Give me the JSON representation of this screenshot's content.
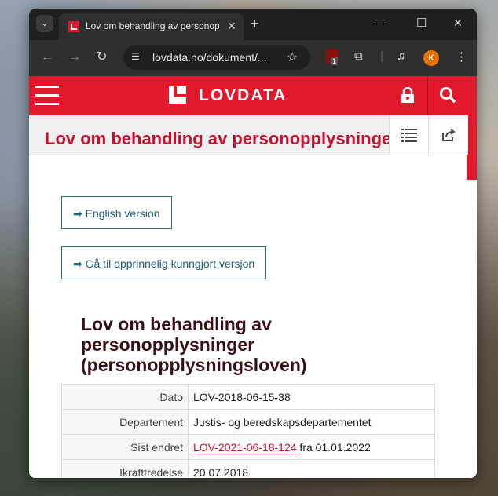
{
  "browser": {
    "tab_title": "Lov om behandling av personopplysninger",
    "url": "lovdata.no/dokument/...",
    "profile_initial": "K",
    "extension_badge": "1"
  },
  "site": {
    "brand": "LOVDATA",
    "page_title": "Lov om behandling av personopplysninger",
    "buttons": {
      "english": "➡ English version",
      "original": "➡ Gå til opprinnelig kunngjort versjon"
    },
    "heading_lines": [
      "Lov om behandling av",
      "personopplysninger",
      "(personopplysningsloven)"
    ],
    "meta": [
      {
        "key": "Dato",
        "value": "LOV-2018-06-15-38"
      },
      {
        "key": "Departement",
        "value": "Justis- og beredskapsdepartementet"
      },
      {
        "key": "Sist endret",
        "link": "LOV-2021-06-18-124",
        "suffix": " fra 01.01.2022"
      },
      {
        "key": "Ikrafttredelse",
        "value": "20.07.2018"
      }
    ]
  },
  "colors": {
    "brand_red": "#e2192c",
    "title_red": "#c8102e",
    "link_blue": "#1f5e77"
  }
}
